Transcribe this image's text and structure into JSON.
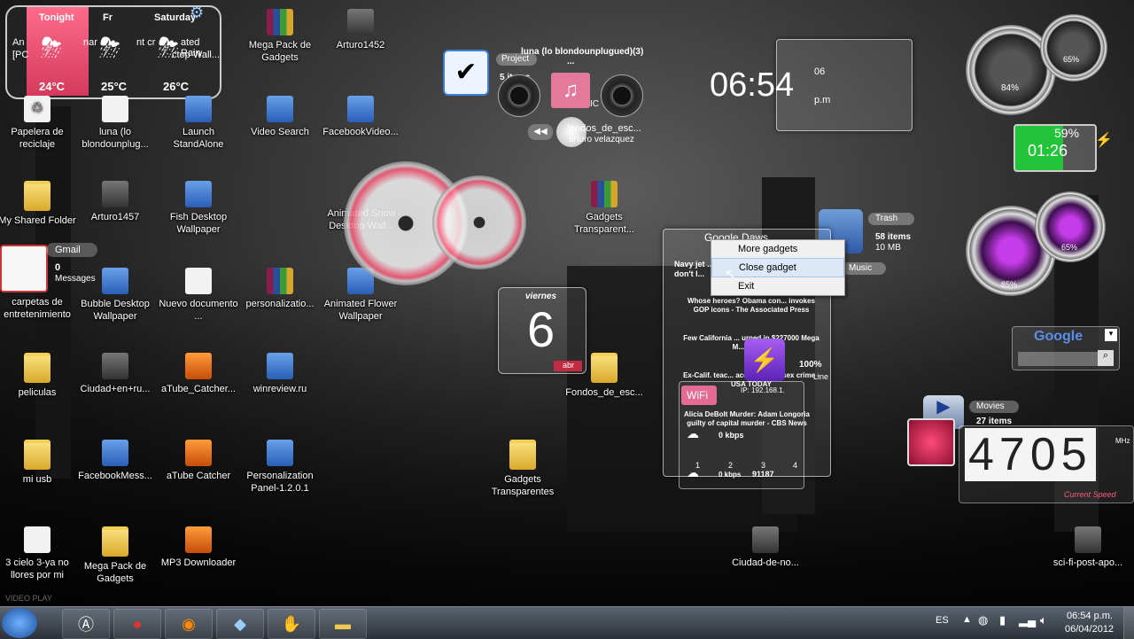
{
  "weather": {
    "days": [
      "Tonight",
      "Fr",
      "Saturday"
    ],
    "temps": [
      "24°C",
      "25°C",
      "26°C"
    ],
    "behind_text": [
      "An",
      "[PC",
      "nar",
      "nt cr",
      "ated Rain",
      "ctop Wall..."
    ]
  },
  "desktop_icons": [
    {
      "label": "Mega Pack de Gadgets"
    },
    {
      "label": "Arturo1452"
    },
    {
      "label": "Papelera de reciclaje"
    },
    {
      "label": "luna (lo blondounplug..."
    },
    {
      "label": "Launch StandAlone"
    },
    {
      "label": "Video Search"
    },
    {
      "label": "FacebookVideo..."
    },
    {
      "label": "My Shared Folder"
    },
    {
      "label": "Arturo1457"
    },
    {
      "label": "Fish Desktop Wallpaper"
    },
    {
      "label": "Animated Snow Desktop Wall..."
    },
    {
      "label": "Gadgets Transparent..."
    },
    {
      "label": "carpetas de entretenimiento"
    },
    {
      "label": "Bubble Desktop Wallpaper"
    },
    {
      "label": "Nuevo documento ..."
    },
    {
      "label": "personalizatio..."
    },
    {
      "label": "Animated Flower Wallpaper"
    },
    {
      "label": "peliculas"
    },
    {
      "label": "Ciudad+en+ru..."
    },
    {
      "label": "aTube_Catcher..."
    },
    {
      "label": "winreview.ru"
    },
    {
      "label": "Fondos_de_esc..."
    },
    {
      "label": "mi usb"
    },
    {
      "label": "FacebookMess..."
    },
    {
      "label": "aTube Catcher"
    },
    {
      "label": "Personalization Panel-1.2.0.1"
    },
    {
      "label": "Gadgets Transparentes"
    },
    {
      "label": "3 cielo 3-ya no llores por mi"
    },
    {
      "label": "Mega Pack de Gadgets"
    },
    {
      "label": "MP3 Downloader"
    },
    {
      "label": "Ciudad-de-no..."
    },
    {
      "label": "sci-fi-post-apo..."
    }
  ],
  "gmail": {
    "title": "Gmail",
    "count": "0",
    "label": "Messages"
  },
  "media": {
    "project_label": "Project",
    "track": "luna (lo blondounplugued)(3)",
    "track_sub": "...",
    "items_label": "5 items",
    "icons_text": "IC",
    "fondos": "fondos_de_esc...",
    "artist": "arturo velazquez"
  },
  "clock": {
    "time": "06:54",
    "ampm_top": "06",
    "ampm_bottom": "p.m"
  },
  "gauges": {
    "cpu1": "84%",
    "cpu2": "65%",
    "mem1": "85%",
    "mem2": "65%"
  },
  "battery": {
    "percent": "59%",
    "time": "01:26"
  },
  "trash": {
    "title": "Trash",
    "items": "58 items",
    "size": "10 MB"
  },
  "music_label": "Music",
  "calendar": {
    "day": "viernes",
    "date": "6",
    "month": "abr"
  },
  "news": {
    "title": "Google Daws",
    "headlines": [
      "Navy jet ... don't l...",
      "Whose heroes? Obama con... invokes GOP icons - The Associated Press",
      "Few California ... urned in $227000 Mega M... Lottery",
      "Ex-Calif. teac... accused of ... sex crime - USA TODAY",
      "Alicia DeBolt Murder: Adam Longoria guilty of capital murder - CBS News"
    ],
    "kbps1": "0 kbps",
    "kbps2": "0 kbps",
    "wifi": "WiFi",
    "pages": [
      "1",
      "2",
      "3",
      "4"
    ],
    "extra": "91187",
    "net_percent": "100%",
    "ip": "IP: 192.168.1.",
    "bolt_text": "Line"
  },
  "context_menu": [
    "More gadgets",
    "Close gadget",
    "Exit"
  ],
  "google_search": {
    "logo": "Google",
    "placeholder": ""
  },
  "movies": {
    "title": "Movies",
    "items": "27 items",
    "speed_value": "4705",
    "speed_unit": "MHz",
    "speed_label": "Current Speed"
  },
  "taskbar": {
    "lang": "ES",
    "time": "06:54 p.m.",
    "date": "06/04/2012",
    "watermark": "VIDEO PLAY"
  }
}
